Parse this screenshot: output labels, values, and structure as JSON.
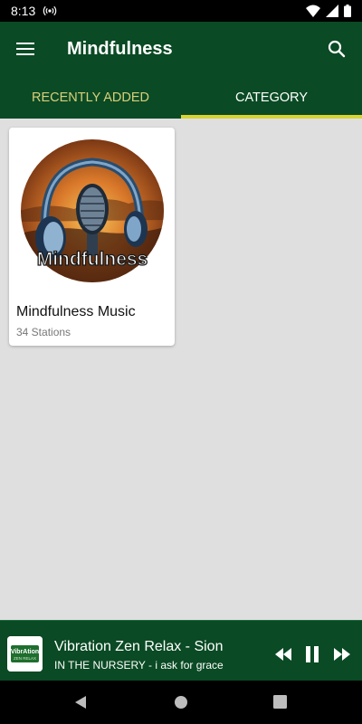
{
  "status": {
    "time": "8:13"
  },
  "app_bar": {
    "title": "Mindfulness"
  },
  "tabs": [
    {
      "label": "RECENTLY ADDED"
    },
    {
      "label": "CATEGORY"
    }
  ],
  "category_card": {
    "art_text": "Mindfulness",
    "title": "Mindfulness Music",
    "subtitle": "34 Stations"
  },
  "player": {
    "logo_text_top": "VibrAtion",
    "logo_text_bottom": "ZEN RELAX",
    "title": "Vibration Zen Relax - Sion",
    "subtitle": "IN THE NURSERY - i ask for grace"
  },
  "colors": {
    "app_bar": "#0a4a24",
    "tab_indicator": "#d8d434",
    "tab_inactive": "#d9cf7a"
  }
}
